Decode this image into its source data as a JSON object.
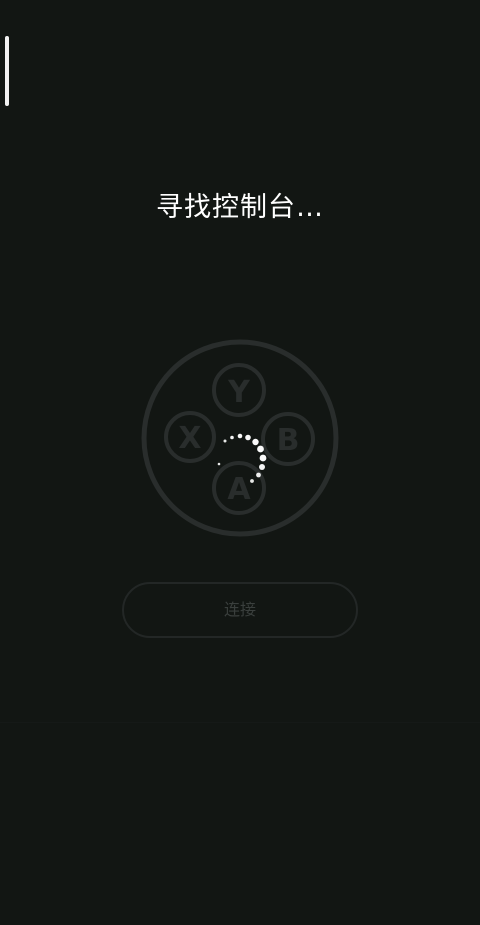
{
  "status": {
    "title": "寻找控制台…"
  },
  "controller": {
    "buttons": [
      "Y",
      "X",
      "B",
      "A"
    ]
  },
  "actions": {
    "connect_label": "连接"
  },
  "colors": {
    "background": "#121613",
    "title": "#ffffff",
    "faded": "#2a2e2d",
    "spinner": "#ffffff"
  }
}
